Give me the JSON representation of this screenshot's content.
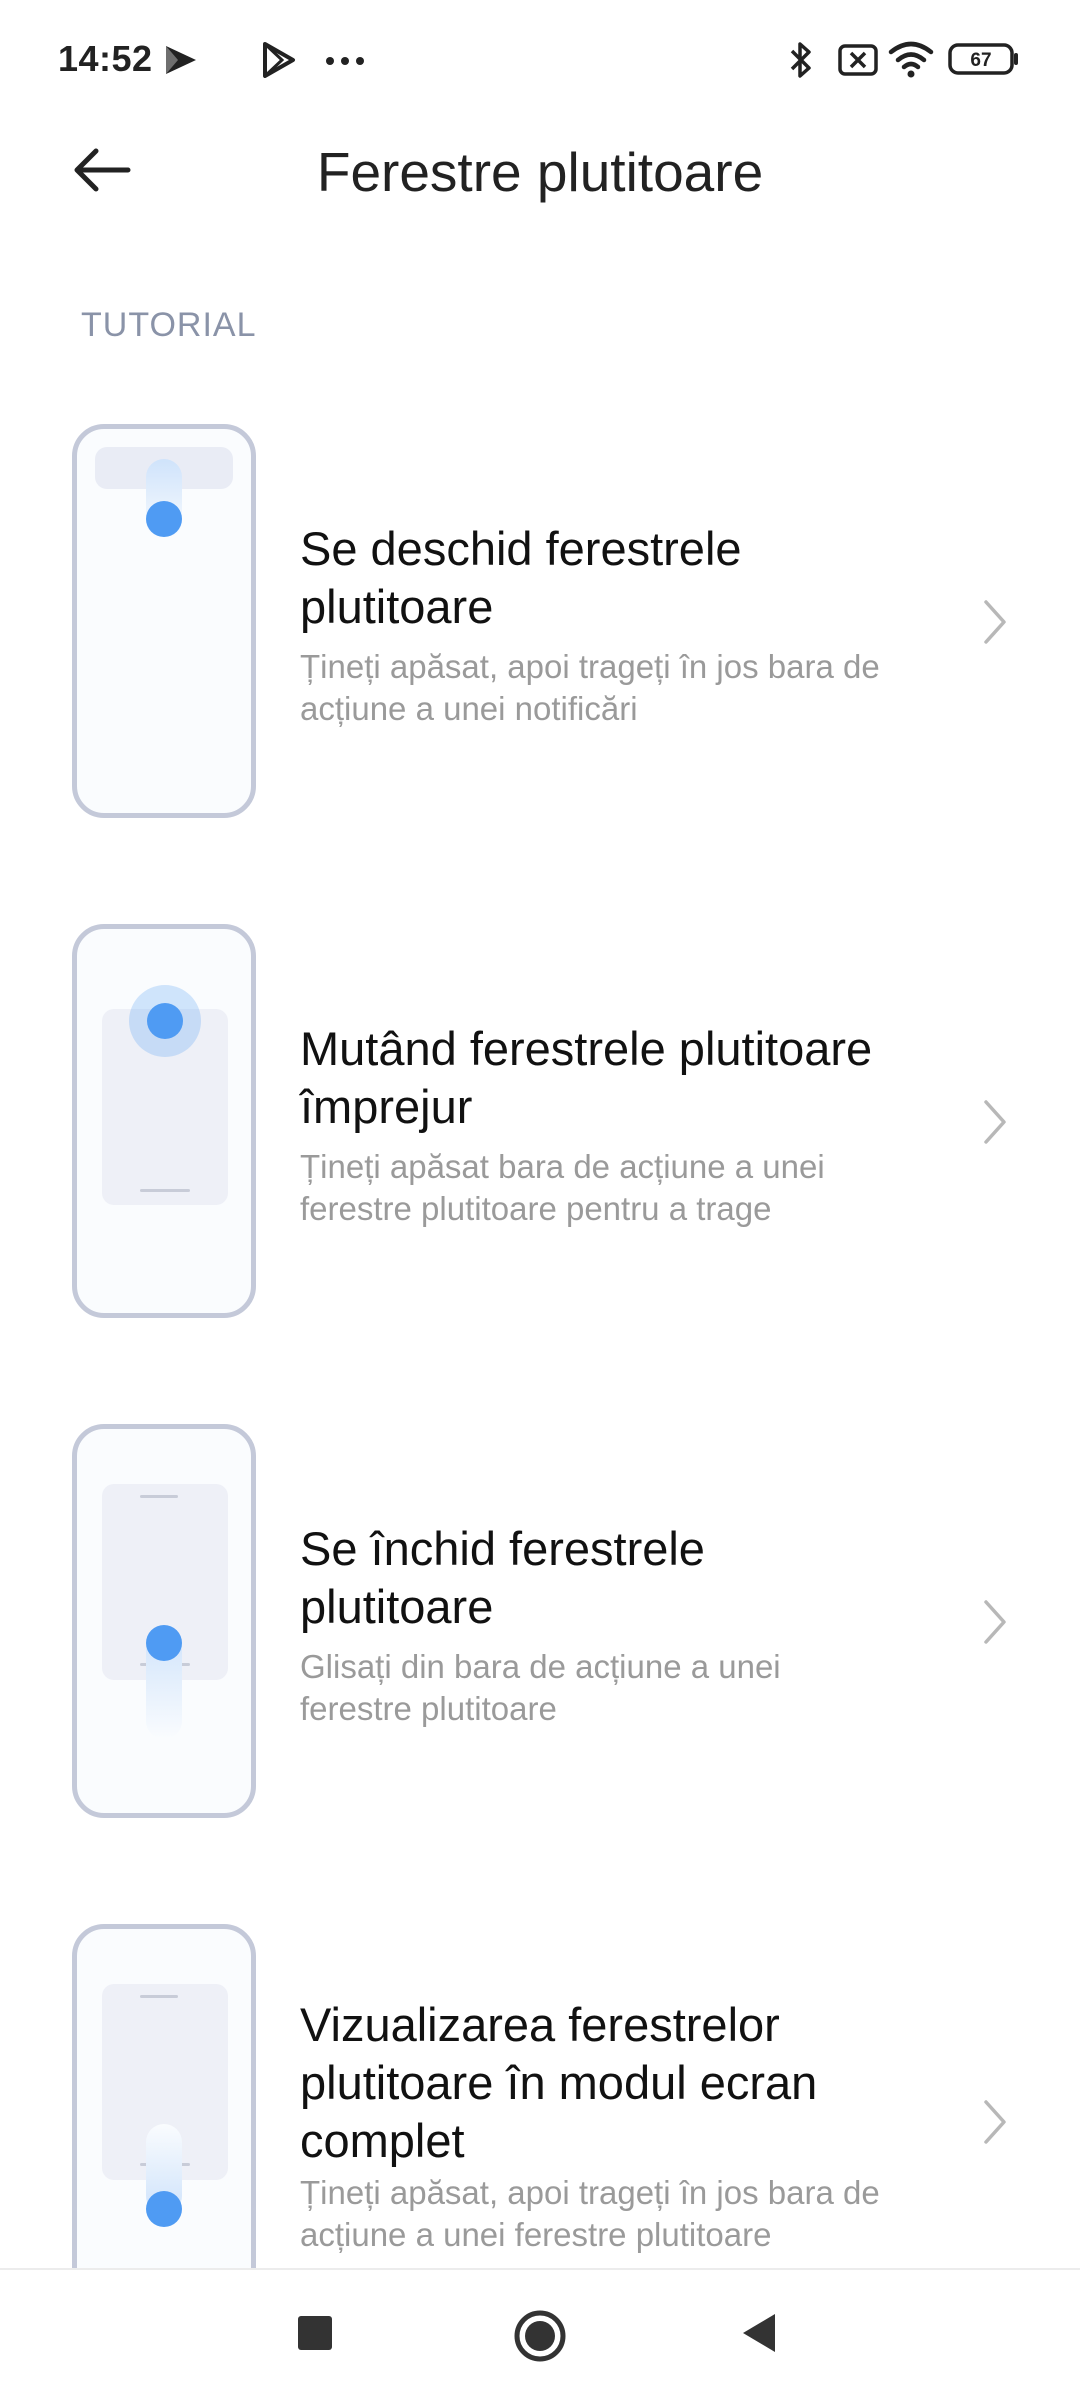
{
  "status_bar": {
    "time": "14:52",
    "battery": "67",
    "icons": [
      "app-notification-icon",
      "play-store-icon",
      "more-dots-icon",
      "bluetooth-icon",
      "no-sim-icon",
      "wifi-icon",
      "battery-icon"
    ]
  },
  "header": {
    "title": "Ferestre plutitoare",
    "back_icon": "arrow-left-icon"
  },
  "section": {
    "label": "TUTORIAL"
  },
  "items": [
    {
      "title_line1": "Se deschid ferestrele",
      "title_line2": "plutitoare",
      "desc_line1": "Țineți apăsat, apoi trageți în jos bara de",
      "desc_line2": "acțiune a unei notificări"
    },
    {
      "title_line1": "Mutând ferestrele plutitoare",
      "title_line2": "împrejur",
      "desc_line1": "Țineți apăsat bara de acțiune a unei",
      "desc_line2": "ferestre plutitoare pentru a trage"
    },
    {
      "title_line1": "Se închid ferestrele",
      "title_line2": "plutitoare",
      "desc_line1": "Glisați din bara de acțiune a unei",
      "desc_line2": "ferestre plutitoare"
    },
    {
      "title_line1": "Vizualizarea ferestrelor",
      "title_line2": "plutitoare în modul ecran",
      "title_line3": "complet",
      "desc_line1": "Țineți apăsat, apoi trageți în jos bara de",
      "desc_line2": "acțiune a unei ferestre plutitoare"
    }
  ],
  "nav_bar": {
    "buttons": [
      "recents-square-icon",
      "home-circle-icon",
      "back-triangle-icon"
    ]
  },
  "colors": {
    "accent_blue": "#4f9bf3",
    "frame_gray": "#c4c9d9",
    "section_label": "#8a93a8",
    "desc_gray": "#9a9a9a"
  }
}
